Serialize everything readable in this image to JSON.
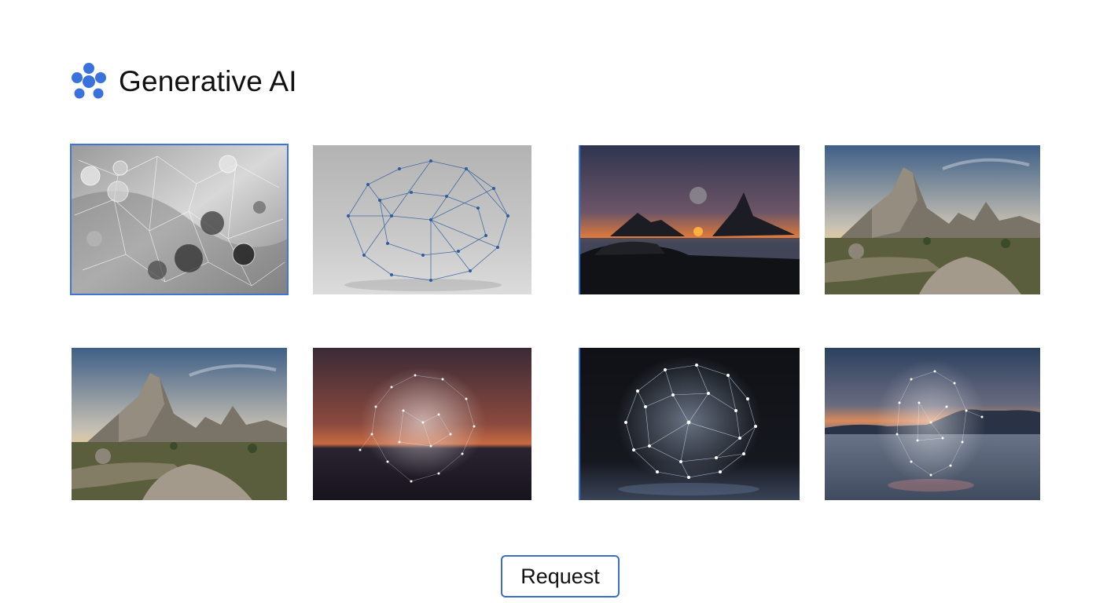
{
  "header": {
    "logo_icon": "blue-dots-logo-icon",
    "title": "Generative AI"
  },
  "gallery": {
    "tiles": [
      {
        "icon": "glass-spheres-network-image",
        "selected": true
      },
      {
        "icon": "blue-node-network-image",
        "selected": false
      },
      {
        "icon": "mountain-sunset-image",
        "selected": false
      },
      {
        "icon": "rocky-mountain-landscape-image",
        "selected": false
      },
      {
        "icon": "rocky-mountain-landscape-image",
        "selected": false
      },
      {
        "icon": "sunset-particle-cloud-image",
        "selected": false
      },
      {
        "icon": "glowing-node-sphere-image",
        "selected": false
      },
      {
        "icon": "lake-particle-cloud-image",
        "selected": false
      }
    ]
  },
  "actions": {
    "request_label": "Request"
  },
  "colors": {
    "accent": "#3d76d6",
    "background": "#ffffff",
    "text": "#111111"
  }
}
